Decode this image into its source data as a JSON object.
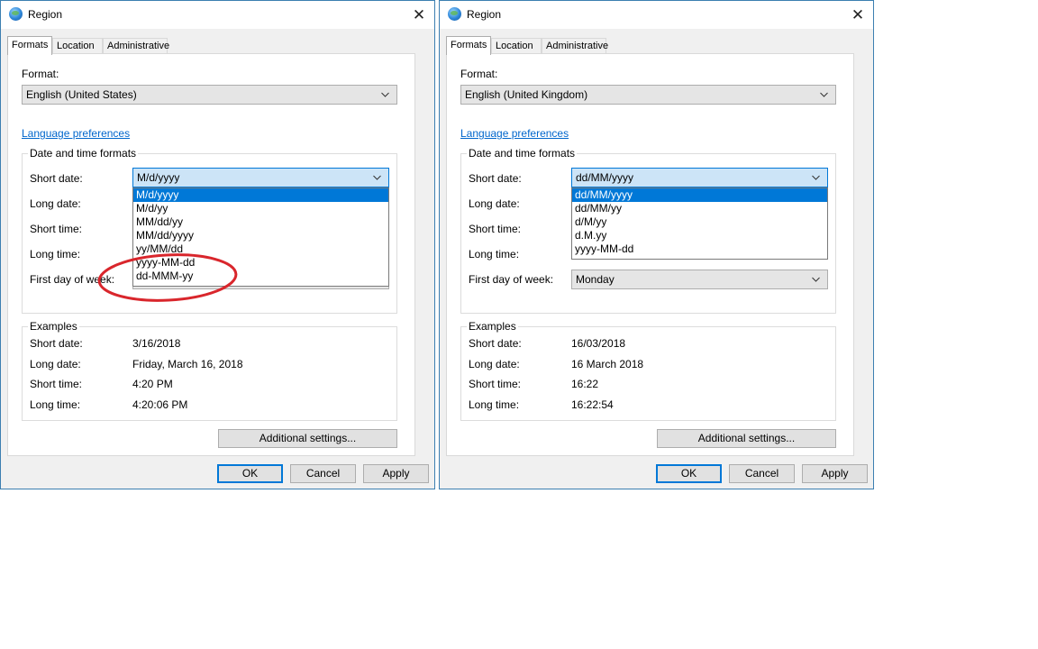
{
  "left_dialog": {
    "title": "Region",
    "close": "✕",
    "tabs": [
      "Formats",
      "Location",
      "Administrative"
    ],
    "format_label": "Format:",
    "format_value": "English (United States)",
    "language_link": "Language preferences",
    "datetime_group": "Date and time formats",
    "short_date_label": "Short date:",
    "short_date_value": "M/d/yyyy",
    "long_date_label": "Long date:",
    "short_time_label": "Short time:",
    "long_time_label": "Long time:",
    "first_day_label": "First day of week:",
    "dropdown_items": [
      "M/d/yyyy",
      "M/d/yy",
      "MM/dd/yy",
      "MM/dd/yyyy",
      "yy/MM/dd",
      "yyyy-MM-dd",
      "dd-MMM-yy"
    ],
    "examples_group": "Examples",
    "examples": [
      {
        "label": "Short date:",
        "value": "3/16/2018"
      },
      {
        "label": "Long date:",
        "value": "Friday, March 16, 2018"
      },
      {
        "label": "Short time:",
        "value": "4:20 PM"
      },
      {
        "label": "Long time:",
        "value": "4:20:06 PM"
      }
    ],
    "additional_settings": "Additional settings...",
    "ok": "OK",
    "cancel": "Cancel",
    "apply": "Apply"
  },
  "right_dialog": {
    "title": "Region",
    "close": "✕",
    "tabs": [
      "Formats",
      "Location",
      "Administrative"
    ],
    "format_label": "Format:",
    "format_value": "English (United Kingdom)",
    "language_link": "Language preferences",
    "datetime_group": "Date and time formats",
    "short_date_label": "Short date:",
    "short_date_value": "dd/MM/yyyy",
    "long_date_label": "Long date:",
    "short_time_label": "Short time:",
    "long_time_label": "Long time:",
    "first_day_label": "First day of week:",
    "first_day_value": "Monday",
    "dropdown_items": [
      "dd/MM/yyyy",
      "dd/MM/yy",
      "d/M/yy",
      "d.M.yy",
      "yyyy-MM-dd"
    ],
    "examples_group": "Examples",
    "examples": [
      {
        "label": "Short date:",
        "value": "16/03/2018"
      },
      {
        "label": "Long date:",
        "value": "16 March 2018"
      },
      {
        "label": "Short time:",
        "value": "16:22"
      },
      {
        "label": "Long time:",
        "value": "16:22:54"
      }
    ],
    "additional_settings": "Additional settings...",
    "ok": "OK",
    "cancel": "Cancel",
    "apply": "Apply"
  },
  "colors": {
    "accent": "#0078d7",
    "link": "#0066cc",
    "annotation": "#d9262c"
  }
}
